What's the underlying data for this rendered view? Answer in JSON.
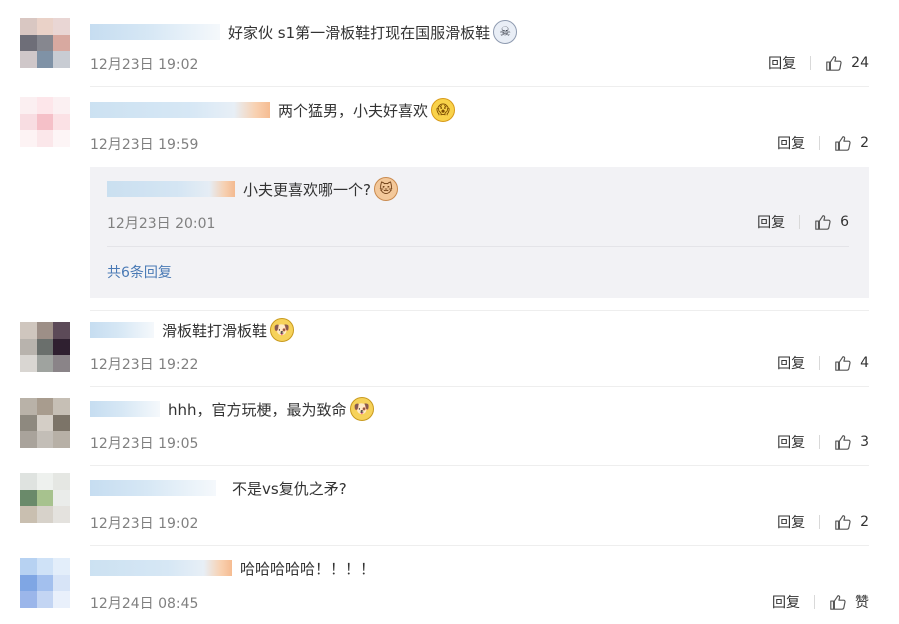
{
  "actions": {
    "reply_label": "回复"
  },
  "comments": [
    {
      "text": "好家伙 s1第一滑板鞋打现在国服滑板鞋",
      "emoji": "☠",
      "time": "12月23日 19:02",
      "likes": "24"
    },
    {
      "text": "两个猛男，小夫好喜欢",
      "emoji": "😱",
      "time": "12月23日 19:59",
      "likes": "2"
    },
    {
      "text": "滑板鞋打滑板鞋",
      "emoji": "🐶",
      "time": "12月23日 19:22",
      "likes": "4"
    },
    {
      "text": "hhh，官方玩梗，最为致命",
      "emoji": "🐶",
      "time": "12月23日 19:05",
      "likes": "3"
    },
    {
      "text": "不是vs复仇之矛?",
      "emoji": "",
      "time": "12月23日 19:02",
      "likes": "2"
    },
    {
      "text": "哈哈哈哈哈！！！！",
      "emoji": "",
      "time": "12月24日 08:45",
      "likes": "赞"
    }
  ],
  "sub_reply": {
    "text": "小夫更喜欢哪一个?",
    "emoji": "🐱",
    "time": "12月23日 20:01",
    "likes": "6",
    "more_label": "共6条回复"
  },
  "colors": {
    "link": "#4a7ab5",
    "muted_text": "#808080",
    "sub_reply_bg": "#f2f2f5"
  },
  "icons": {
    "like": "thumbs-up-outline-icon",
    "sticker": "sticker-emoji-icon"
  }
}
